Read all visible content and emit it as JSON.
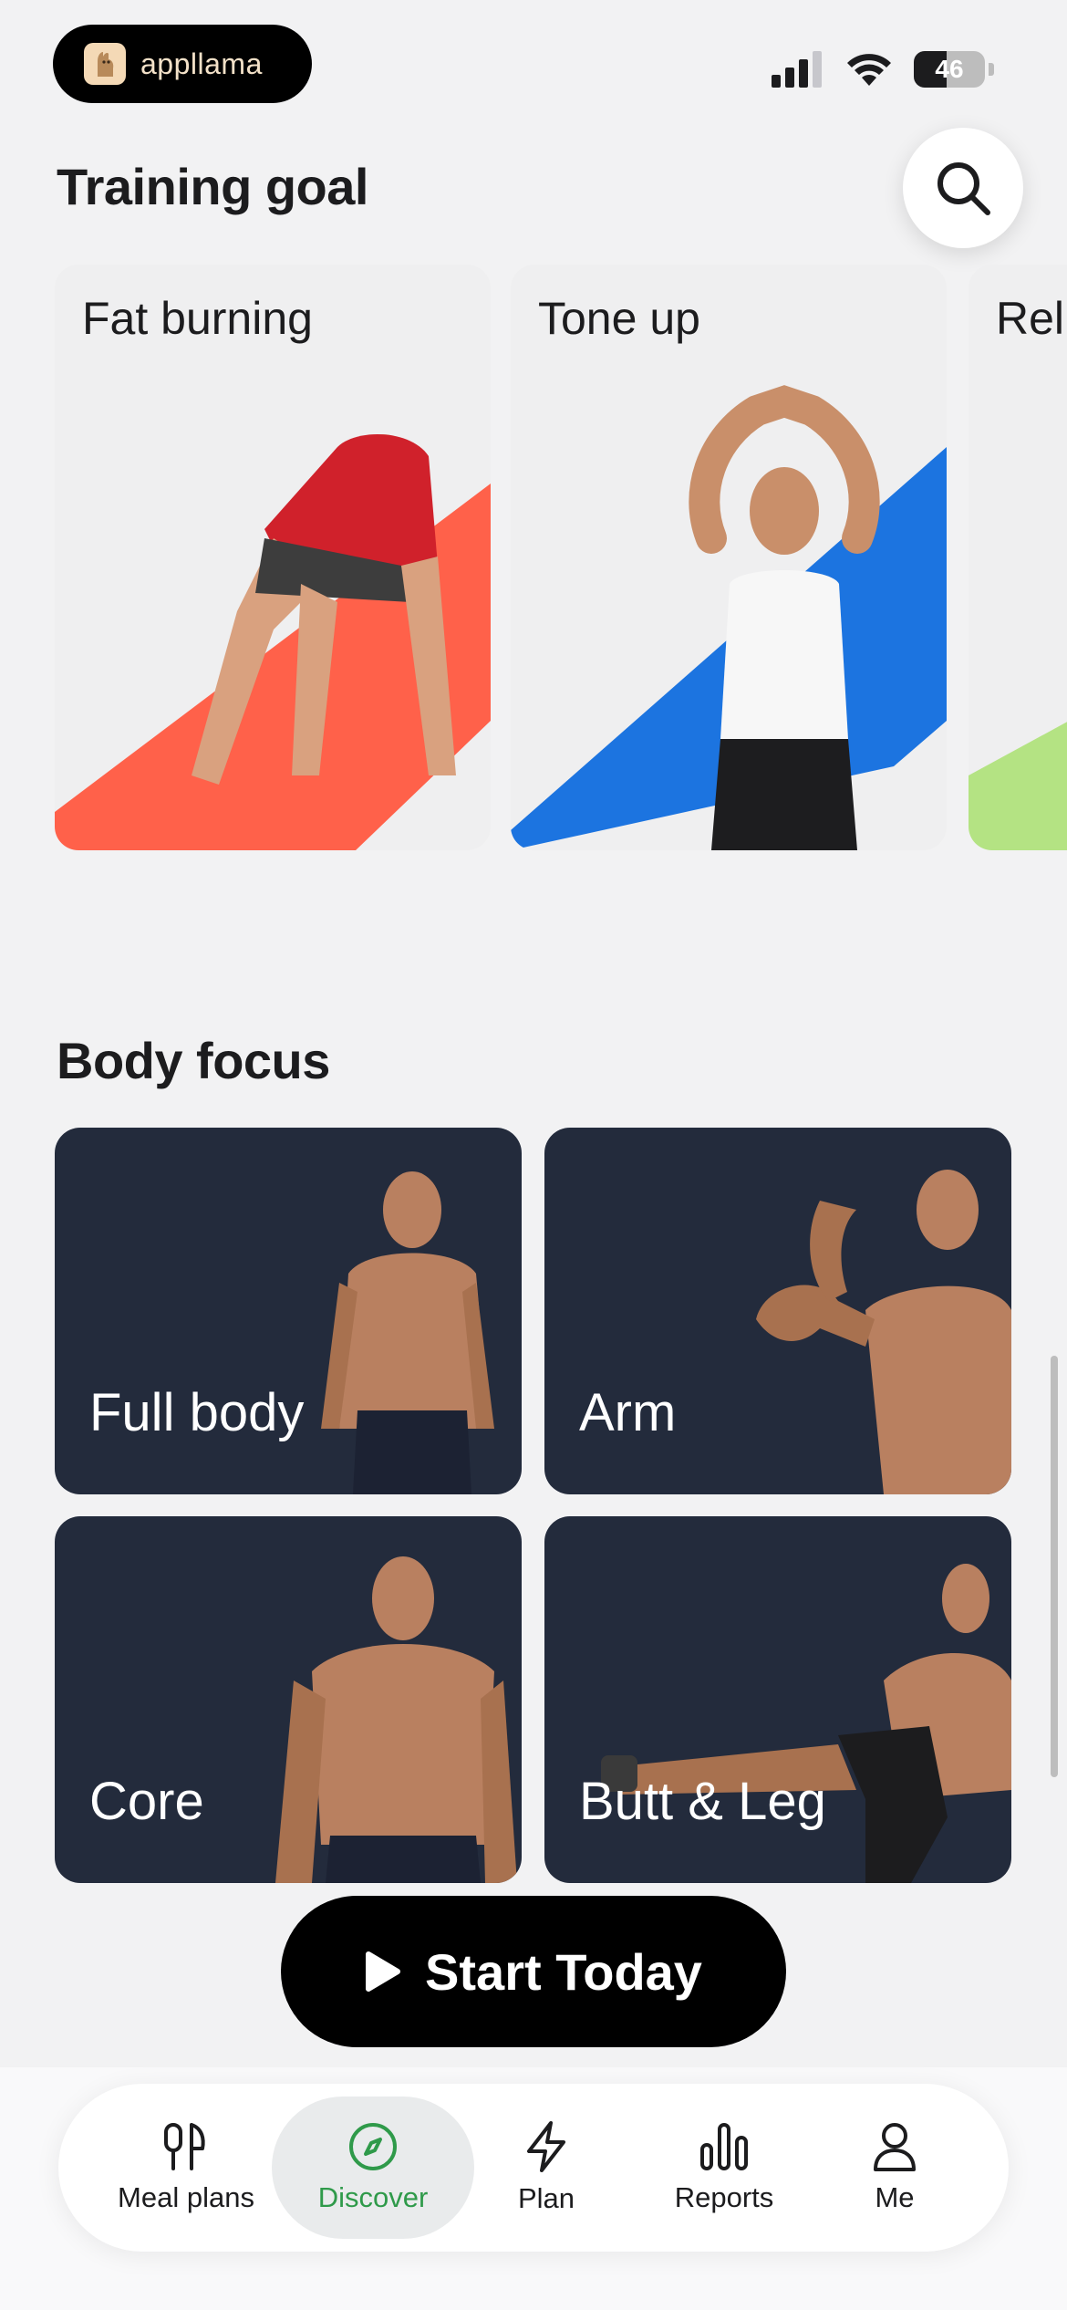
{
  "status_bar": {
    "app_pill_label": "appllama",
    "battery": "46"
  },
  "training_goal": {
    "title": "Training goal",
    "cards": [
      {
        "label": "Fat burning",
        "stripe_color": "#ff614a"
      },
      {
        "label": "Tone up",
        "stripe_color": "#1c74e0"
      },
      {
        "label": "Rel",
        "stripe_color": "#b4e383"
      }
    ]
  },
  "body_focus": {
    "title": "Body focus",
    "cards": [
      {
        "label": "Full body"
      },
      {
        "label": "Arm"
      },
      {
        "label": "Core"
      },
      {
        "label": "Butt & Leg"
      }
    ]
  },
  "start_button": {
    "label": "Start Today"
  },
  "tabs": [
    {
      "label": "Meal plans",
      "icon": "utensils-icon",
      "active": false
    },
    {
      "label": "Discover",
      "icon": "compass-icon",
      "active": true
    },
    {
      "label": "Plan",
      "icon": "lightning-icon",
      "active": false
    },
    {
      "label": "Reports",
      "icon": "bar-chart-icon",
      "active": false
    },
    {
      "label": "Me",
      "icon": "person-icon",
      "active": false
    }
  ],
  "colors": {
    "accent": "#2f9a4a",
    "card_dark": "#232b3c",
    "background": "#f2f2f3"
  }
}
